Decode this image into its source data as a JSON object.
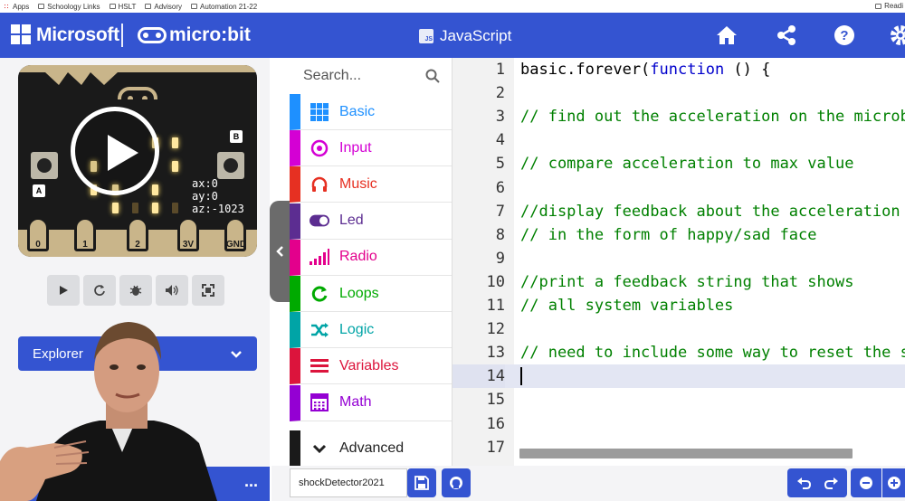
{
  "bookmarks": {
    "items": [
      "Apps",
      "Schoology Links",
      "HSLT",
      "Advisory",
      "Automation 21-22"
    ],
    "right": "Readi"
  },
  "header": {
    "brand": "Microsoft",
    "product": "micro:bit",
    "language_badge": "JS",
    "language": "JavaScript",
    "icons": [
      "home-icon",
      "share-icon",
      "help-icon",
      "settings-icon"
    ]
  },
  "simulator": {
    "accelerometer": [
      "ax:0",
      "ay:0",
      "az:-1023"
    ],
    "pins": [
      "0",
      "1",
      "2",
      "3V",
      "GND"
    ],
    "buttons": [
      "A",
      "B"
    ],
    "controls": [
      "play-icon",
      "restart-icon",
      "debug-icon",
      "mute-icon",
      "fullscreen-icon"
    ],
    "explorer_label": "Explorer"
  },
  "toolbox": {
    "search_placeholder": "Search...",
    "categories": [
      {
        "label": "Basic",
        "color": "#1e90ff",
        "icon": "grid-icon"
      },
      {
        "label": "Input",
        "color": "#d400d4",
        "icon": "target-icon"
      },
      {
        "label": "Music",
        "color": "#e63022",
        "icon": "headphones-icon"
      },
      {
        "label": "Led",
        "color": "#5c2d91",
        "icon": "toggle-icon"
      },
      {
        "label": "Radio",
        "color": "#e3008c",
        "icon": "signal-icon"
      },
      {
        "label": "Loops",
        "color": "#00aa00",
        "icon": "refresh-icon"
      },
      {
        "label": "Logic",
        "color": "#00a4a6",
        "icon": "shuffle-icon"
      },
      {
        "label": "Variables",
        "color": "#dc143c",
        "icon": "list-icon"
      },
      {
        "label": "Math",
        "color": "#9400d3",
        "icon": "calculator-icon"
      }
    ],
    "advanced_label": "Advanced"
  },
  "editor": {
    "active_line": 14,
    "lines": [
      {
        "num": "1",
        "parts": [
          {
            "t": "basic.forever(",
            "c": ""
          },
          {
            "t": "function",
            "c": "kw"
          },
          {
            "t": " () {",
            "c": ""
          }
        ]
      },
      {
        "num": "2",
        "parts": []
      },
      {
        "num": "3",
        "parts": [
          {
            "t": "// find out the acceleration on the microbit",
            "c": "cm"
          }
        ]
      },
      {
        "num": "4",
        "parts": []
      },
      {
        "num": "5",
        "parts": [
          {
            "t": "// compare acceleration to max value",
            "c": "cm"
          }
        ]
      },
      {
        "num": "6",
        "parts": []
      },
      {
        "num": "7",
        "parts": [
          {
            "t": "//display feedback about the acceleration",
            "c": "cm"
          }
        ]
      },
      {
        "num": "8",
        "parts": [
          {
            "t": "// in the form of happy/sad face",
            "c": "cm"
          }
        ]
      },
      {
        "num": "9",
        "parts": []
      },
      {
        "num": "10",
        "parts": [
          {
            "t": "//print a feedback string that shows",
            "c": "cm"
          }
        ]
      },
      {
        "num": "11",
        "parts": [
          {
            "t": "// all system variables",
            "c": "cm"
          }
        ]
      },
      {
        "num": "12",
        "parts": []
      },
      {
        "num": "13",
        "parts": [
          {
            "t": "// need to include some way to reset the s",
            "c": "cm"
          }
        ]
      },
      {
        "num": "14",
        "parts": []
      },
      {
        "num": "15",
        "parts": []
      },
      {
        "num": "16",
        "parts": []
      },
      {
        "num": "17",
        "parts": []
      }
    ]
  },
  "bottombar": {
    "project_name": "shockDetector2021",
    "more_label": "...",
    "icons": [
      "save-icon",
      "github-icon",
      "undo-icon",
      "redo-icon",
      "zoom-out-icon",
      "zoom-in-icon"
    ]
  },
  "colors": {
    "brand_blue": "#3454d1",
    "comment_green": "#008000",
    "keyword_blue": "#0000cc"
  }
}
